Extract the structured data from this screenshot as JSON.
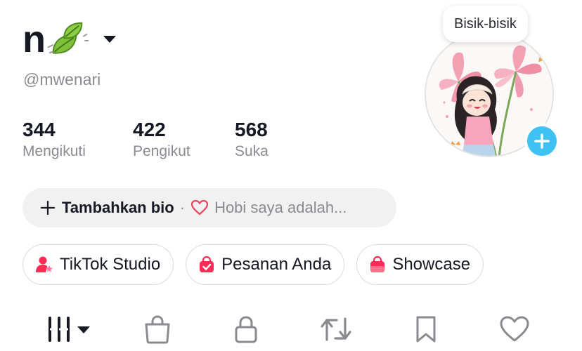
{
  "profile": {
    "name": "n",
    "handle": "@mwenari",
    "bubble": "Bisik-bisik"
  },
  "stats": [
    {
      "value": "344",
      "label": "Mengikuti"
    },
    {
      "value": "422",
      "label": "Pengikut"
    },
    {
      "value": "568",
      "label": "Suka"
    }
  ],
  "bio": {
    "add_label": "Tambahkan bio",
    "separator": "·",
    "hint": "Hobi saya adalah..."
  },
  "chips": [
    {
      "label": "TikTok Studio",
      "icon": "person-star-icon"
    },
    {
      "label": "Pesanan Anda",
      "icon": "order-bag-icon"
    },
    {
      "label": "Showcase",
      "icon": "shopping-bag-icon"
    }
  ],
  "tabs": [
    {
      "icon": "grid-icon",
      "active": true
    },
    {
      "icon": "bag-icon"
    },
    {
      "icon": "lock-icon"
    },
    {
      "icon": "repost-icon"
    },
    {
      "icon": "bookmark-icon"
    },
    {
      "icon": "heart-icon"
    }
  ],
  "colors": {
    "accent_pink": "#fe2c55",
    "gray_text": "#8a8b91",
    "add_button": "#3ec1f3"
  }
}
